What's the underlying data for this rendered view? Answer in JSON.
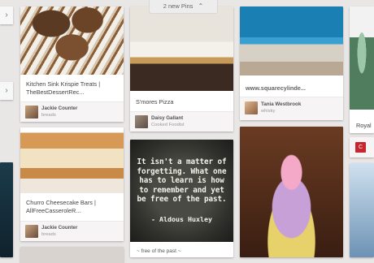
{
  "banner": {
    "new_pins": "2 new Pins",
    "arrow": "⌃"
  },
  "side_nav": {
    "arrow1": "›",
    "arrow2": "›"
  },
  "pins": [
    {
      "title": "Kitchen Sink Krispie Treats | TheBestDessertRec...",
      "user": "Jackie Counter",
      "board": "breads"
    },
    {
      "title": "S'mores Pizza",
      "user": "Daisy Gallant",
      "board": "Cooked Foodist"
    },
    {
      "title": "www.squarecylinde...",
      "user": "Tania Westbrook",
      "board": "whisky"
    },
    {
      "title": "Churro Cheesecake Bars | AllFreeCasseroleR...",
      "user": "Jackie Counter",
      "board": "breads"
    },
    {
      "quote": "It isn't a matter of forgetting. What one has to learn is how to remember and yet be free of the past.",
      "author": "- Aldous Huxley",
      "caption": "~ free of the past ~"
    },
    {
      "caption": "Royal"
    },
    {
      "icon": "C"
    }
  ],
  "colors": {
    "page_bg": "#e9e6e6",
    "brand_red": "#c8262e"
  }
}
